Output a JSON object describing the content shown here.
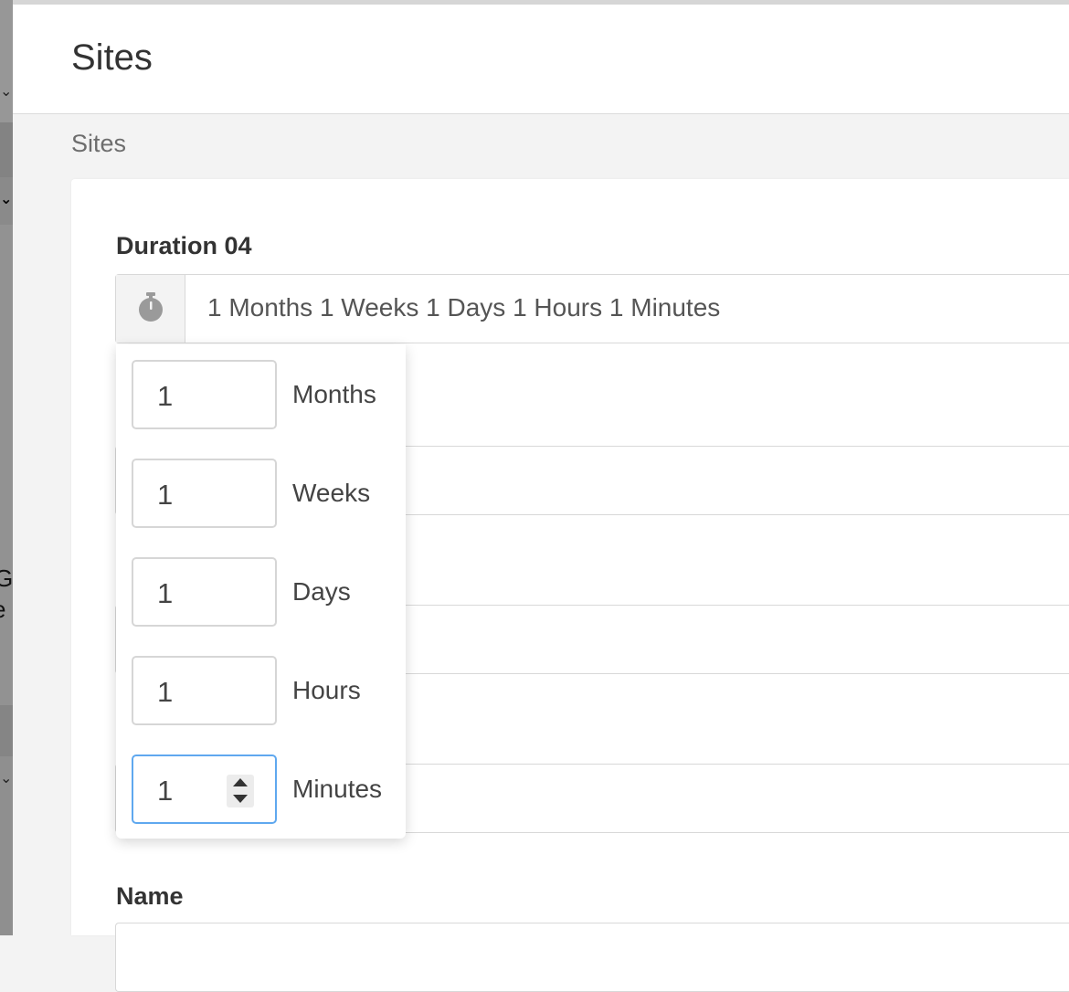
{
  "page": {
    "title": "Sites"
  },
  "breadcrumb": {
    "current": "Sites"
  },
  "left_fragments": [
    "G",
    "e"
  ],
  "form": {
    "duration": {
      "label": "Duration 04",
      "icon": "stopwatch-icon",
      "display_value": "1 Months 1 Weeks 1 Days 1 Hours 1 Minutes"
    },
    "name": {
      "label": "Name"
    }
  },
  "duration_picker": {
    "rows": [
      {
        "value": "1",
        "unit": "Months"
      },
      {
        "value": "1",
        "unit": "Weeks"
      },
      {
        "value": "1",
        "unit": "Days"
      },
      {
        "value": "1",
        "unit": "Hours"
      },
      {
        "value": "1",
        "unit": "Minutes",
        "focused": true
      }
    ]
  },
  "colors": {
    "focus_border": "#5fa8ef",
    "addon_bg": "#f3f3f3"
  }
}
